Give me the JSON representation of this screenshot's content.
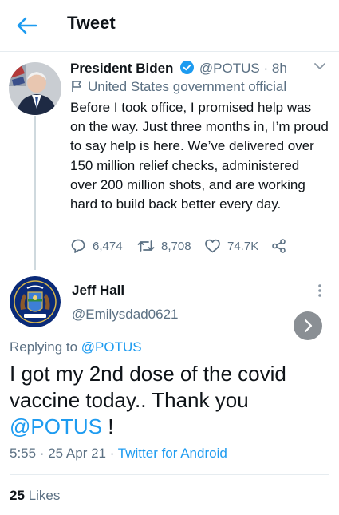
{
  "header": {
    "title": "Tweet"
  },
  "parent_tweet": {
    "name": "President Biden",
    "handle": "@POTUS",
    "dot": "·",
    "time": "8h",
    "label": "United States government official",
    "text": "Before I took office, I promised help was on the way. Just three months in, I’m proud to say help is here. We’ve delivered over 150 million relief checks, administered over 200 million shots, and are working hard to build back better every day.",
    "replies": "6,474",
    "retweets": "8,708",
    "likes": "74.7K"
  },
  "reply_tweet": {
    "name": "Jeff Hall",
    "handle": "@Emilysdad0621",
    "replying_prefix": "Replying to ",
    "replying_to": "@POTUS",
    "text_main": "I got my 2nd dose of the covid vaccine today.. Thank you ",
    "text_mention": "@POTUS",
    "text_end": " !",
    "time": "5:55",
    "dot1": " · ",
    "date": "25 Apr 21",
    "dot2": " · ",
    "source": "Twitter for Android",
    "likes_count": "25",
    "likes_label": "Likes"
  },
  "colors": {
    "accent": "#1d9bf0",
    "verified": "#1d9bf0",
    "muted": "#5b7083"
  }
}
